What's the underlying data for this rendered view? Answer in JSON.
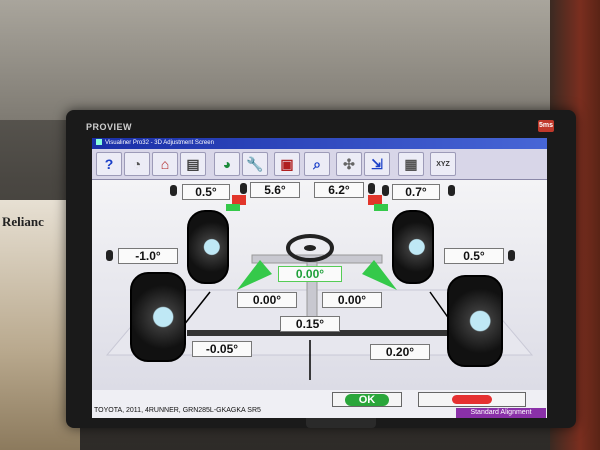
{
  "background": {
    "box_label": "Relianc"
  },
  "monitor": {
    "brand": "PROVIEW",
    "badge": "5ms"
  },
  "window": {
    "title": "Visualiner Pro32 - 3D Adjustment Screen"
  },
  "toolbar": {
    "buttons": [
      {
        "name": "help-button",
        "icon": "question-icon",
        "glyph": "?"
      },
      {
        "name": "speedometer-button",
        "icon": "gauge-icon",
        "glyph": "◔"
      },
      {
        "name": "home-button",
        "icon": "home-icon",
        "glyph": "⌂"
      },
      {
        "name": "print-button",
        "icon": "printer-icon",
        "glyph": "▤"
      },
      {
        "name": "specs-button",
        "icon": "gauge-color-icon",
        "glyph": "◕"
      },
      {
        "name": "tools-button",
        "icon": "wrench-icon",
        "glyph": "🔧"
      },
      {
        "name": "save-button",
        "icon": "save-icon",
        "glyph": "▣"
      },
      {
        "name": "zoom-button",
        "icon": "magnifier-icon",
        "glyph": "⌕"
      },
      {
        "name": "alignment-button",
        "icon": "alignment-icon",
        "glyph": "✣"
      },
      {
        "name": "export-button",
        "icon": "export-icon",
        "glyph": "⇲"
      },
      {
        "name": "table-button",
        "icon": "table-icon",
        "glyph": "▦"
      },
      {
        "name": "axes-button",
        "icon": "xyz-icon",
        "glyph": "XYZ"
      }
    ]
  },
  "front": {
    "camber_left": "0.5°",
    "caster_left": "5.6°",
    "caster_right": "6.2°",
    "camber_right": "0.7°",
    "steering_wheel": "0.00°",
    "toe_left": "0.00°",
    "toe_right": "0.00°"
  },
  "rear": {
    "camber_left": "-1.0°",
    "camber_right": "0.5°",
    "thrust": "0.15°",
    "toe_left": "-0.05°",
    "toe_right": "0.20°"
  },
  "status": {
    "vehicle": "TOYOTA, 2011, 4RUNNER, GRN285L-GKAGKA SR5",
    "ok_label": "OK",
    "mode": "Standard Alignment"
  }
}
